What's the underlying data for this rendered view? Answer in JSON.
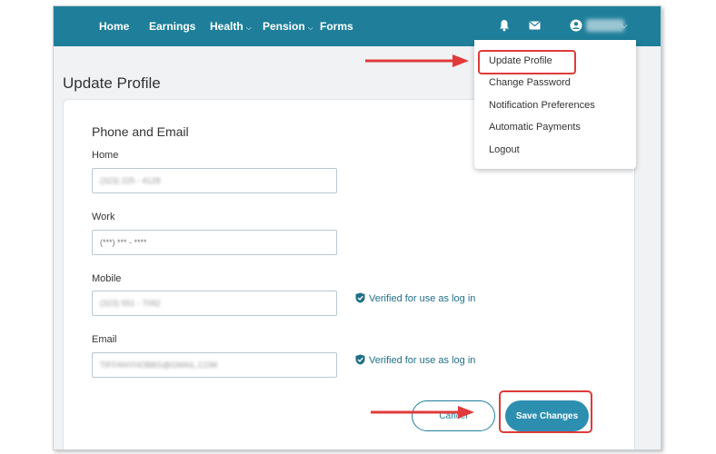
{
  "nav": {
    "items": [
      {
        "label": "Home"
      },
      {
        "label": "Earnings"
      },
      {
        "label": "Health",
        "caret": "⌵"
      },
      {
        "label": "Pension",
        "caret": "⌵"
      },
      {
        "label": "Forms"
      }
    ],
    "icons": [
      "bell-icon",
      "envelope-icon",
      "user-icon",
      "chevron-down-icon"
    ],
    "user_caret": "⌵"
  },
  "page": {
    "title": "Update Profile"
  },
  "form": {
    "section_title": "Phone and Email",
    "fields": [
      {
        "label": "Home",
        "value": "(323) 225 - 4128",
        "blurred": true
      },
      {
        "label": "Work",
        "placeholder": "(***) *** - ****"
      },
      {
        "label": "Mobile",
        "value": "(323) 551 - 7092",
        "blurred": true
      },
      {
        "label": "Email",
        "value": "TIFFANYHOBBS@GMAIL.COM",
        "blurred": true
      }
    ],
    "verified_text": "Verified for use as log in",
    "cancel_label": "Cancel",
    "save_label": "Save Changes"
  },
  "dropdown": {
    "items": [
      "Update Profile",
      "Change Password",
      "Notification Preferences",
      "Automatic Payments",
      "Logout"
    ]
  },
  "colors": {
    "nav_bg": "#1f7f9b",
    "primary_button": "#2d8fb0",
    "highlight": "#e03a3a",
    "verified": "#1f6f87"
  }
}
